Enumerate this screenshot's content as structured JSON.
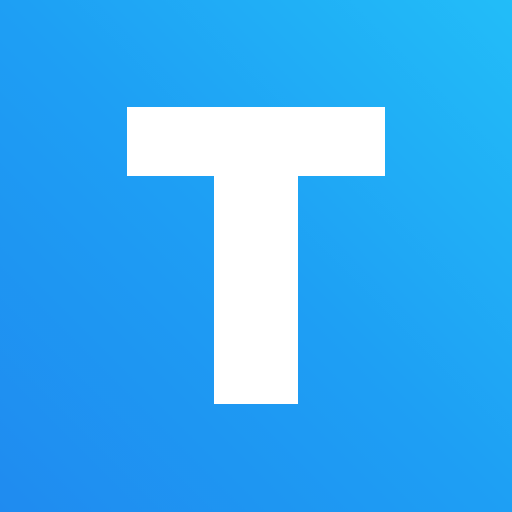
{
  "icon": {
    "glyph": "letter-t-logo",
    "logo_text": "T",
    "colors": {
      "gradient_start": "#1F8BF0",
      "gradient_mid": "#1E9FF4",
      "gradient_end": "#22BDF8",
      "glyph": "#FFFFFF"
    }
  }
}
